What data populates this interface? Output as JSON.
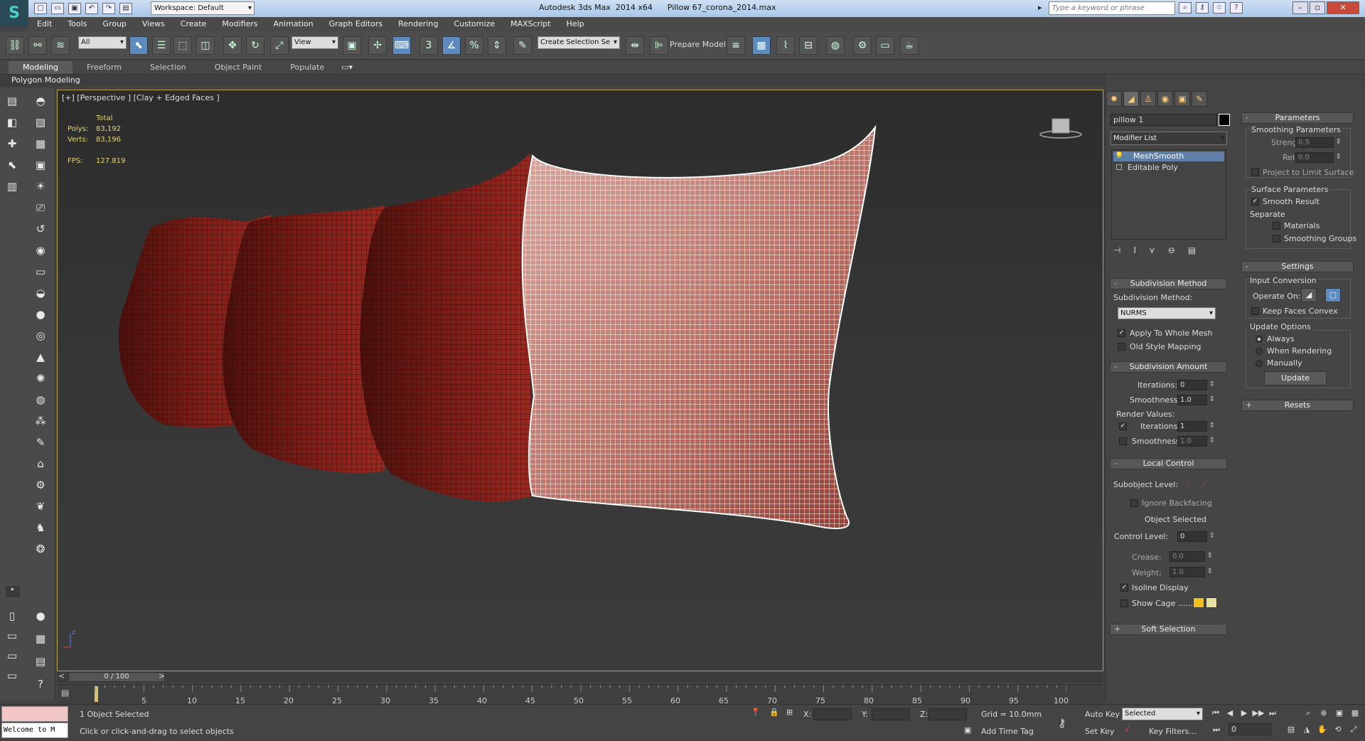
{
  "app": {
    "title": "Autodesk 3ds Max  2014 x64      Pillow 67_corona_2014.max",
    "workspace": "Workspace: Default",
    "search_placeholder": "Type a keyword or phrase",
    "logo": "S"
  },
  "menu": [
    "Edit",
    "Tools",
    "Group",
    "Views",
    "Create",
    "Modifiers",
    "Animation",
    "Graph Editors",
    "Rendering",
    "Customize",
    "MAXScript",
    "Help"
  ],
  "toolbar": {
    "filter": "All",
    "ref_coord": "View",
    "selection_set": "Create Selection Se",
    "snap_label": "3",
    "prepare_model": "Prepare Model"
  },
  "ribbon": {
    "tabs": [
      "Modeling",
      "Freeform",
      "Selection",
      "Object Paint",
      "Populate"
    ],
    "active_tab": "Modeling",
    "panel_label": "Polygon Modeling"
  },
  "viewport": {
    "label": "[+] [Perspective ] [Clay + Edged Faces ]",
    "stats": {
      "total_label": "Total",
      "polys_label": "Polys:",
      "polys_value": "83,192",
      "verts_label": "Verts:",
      "verts_value": "83,196",
      "fps_label": "FPS:",
      "fps_value": "127.819"
    },
    "axis_z": "z"
  },
  "command_panel": {
    "object_name": "pillow 1",
    "object_color": "#000000",
    "modifier_list": "Modifier List",
    "stack": [
      "MeshSmooth",
      "Editable Poly"
    ],
    "subdivision_method": {
      "header": "Subdivision Method",
      "method_label": "Subdivision Method:",
      "method_value": "NURMS",
      "apply_whole_mesh": "Apply To Whole Mesh",
      "old_style_mapping": "Old Style Mapping"
    },
    "subdivision_amount": {
      "header": "Subdivision Amount",
      "iterations_label": "Iterations:",
      "iterations_value": "0",
      "smoothness_label": "Smoothness:",
      "smoothness_value": "1.0",
      "render_values_label": "Render Values:",
      "render_iterations_label": "Iterations:",
      "render_iterations_value": "1",
      "render_smoothness_label": "Smoothness:",
      "render_smoothness_value": "1.0"
    },
    "local_control": {
      "header": "Local Control",
      "subobject_level_label": "Subobject Level:",
      "ignore_backfacing": "Ignore Backfacing",
      "object_selected": "Object Selected",
      "control_level_label": "Control Level:",
      "control_level_value": "0",
      "crease_label": "Crease:",
      "crease_value": "0.0",
      "weight_label": "Weight:",
      "weight_value": "1.0",
      "isoline_display": "Isoline Display",
      "show_cage": "Show Cage ......",
      "cage_color_1": "#f0c020",
      "cage_color_2": "#e8e0a0"
    },
    "soft_selection": {
      "header": "Soft Selection"
    },
    "parameters": {
      "header": "Parameters",
      "smoothing_params": "Smoothing Parameters",
      "strength_label": "Strength:",
      "strength_value": "0.5",
      "relax_label": "Relax:",
      "relax_value": "0.0",
      "project_limit": "Project to Limit Surface",
      "surface_params": "Surface Parameters",
      "smooth_result": "Smooth Result",
      "separate": "Separate",
      "materials": "Materials",
      "smoothing_groups": "Smoothing Groups"
    },
    "settings": {
      "header": "Settings",
      "input_conversion": "Input Conversion",
      "operate_on": "Operate On:",
      "keep_faces_convex": "Keep Faces Convex",
      "update_options": "Update Options",
      "always": "Always",
      "when_rendering": "When Rendering",
      "manually": "Manually",
      "update_button": "Update"
    },
    "resets": {
      "header": "Resets"
    }
  },
  "timeline": {
    "slider_label": "0 / 100",
    "ticks": [
      "5",
      "10",
      "15",
      "20",
      "25",
      "30",
      "35",
      "40",
      "45",
      "50",
      "55",
      "60",
      "65",
      "70",
      "75",
      "80",
      "85",
      "90",
      "95",
      "100"
    ]
  },
  "status": {
    "maxscript_listener": "Welcome to M",
    "selection": "1 Object Selected",
    "prompt": "Click or click-and-drag to select objects",
    "x_label": "X:",
    "y_label": "Y:",
    "z_label": "Z:",
    "grid": "Grid = 10.0mm",
    "add_time_tag": "Add Time Tag",
    "auto_key": "Auto Key",
    "set_key": "Set Key",
    "selected_dd": "Selected",
    "key_filters": "Key Filters...",
    "frame_value": "0"
  },
  "colors": {
    "pillow_dark": "#7a1d17",
    "pillow_selected": "#c78b80",
    "viewport_border": "#b8a448",
    "accent": "#5d8bbf"
  }
}
